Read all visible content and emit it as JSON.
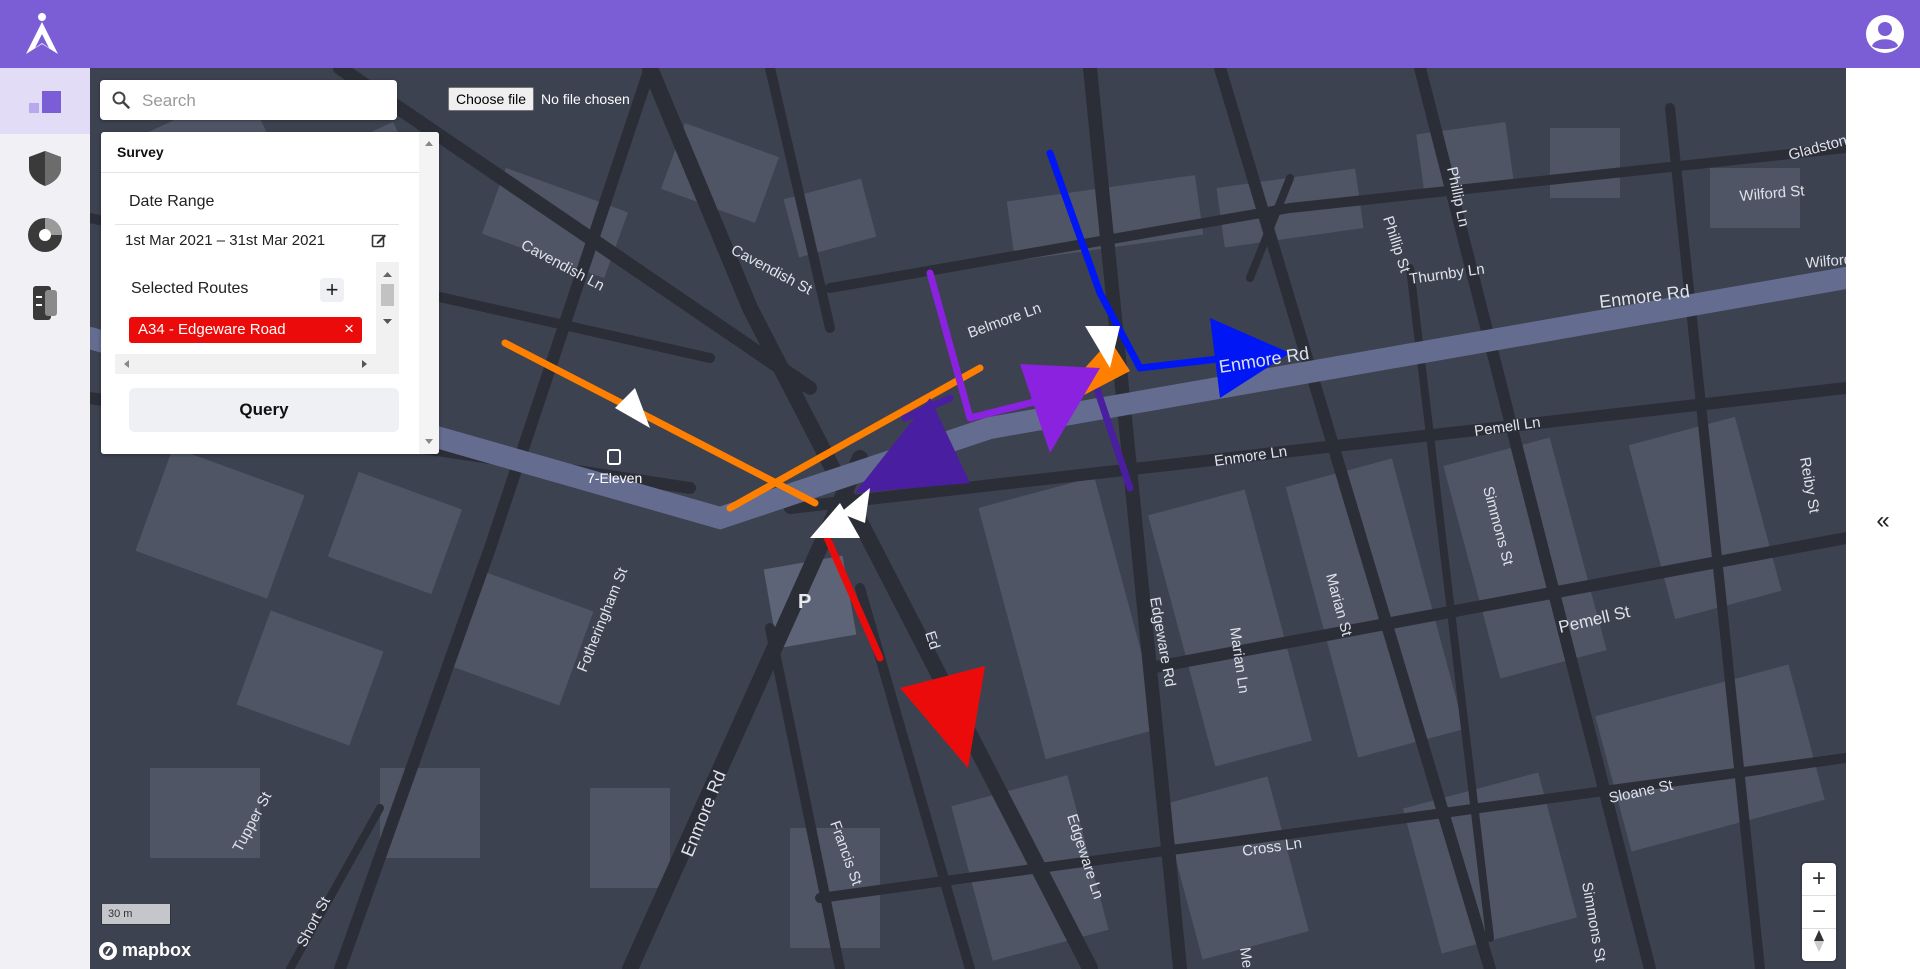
{
  "header": {
    "logo_icon": "compass-a-icon",
    "user_icon": "user-circle-icon",
    "bar_color": "#7b5dd5"
  },
  "sidebar": {
    "items": [
      {
        "name": "dashboard",
        "icon": "squares-icon"
      },
      {
        "name": "security",
        "icon": "shield-icon"
      },
      {
        "name": "analytics",
        "icon": "donut-icon"
      },
      {
        "name": "layers",
        "icon": "layers-icon"
      }
    ]
  },
  "search": {
    "placeholder": "Search"
  },
  "file_input": {
    "button_label": "Choose file",
    "status": "No file chosen"
  },
  "survey_panel": {
    "title": "Survey",
    "date_range_label": "Date Range",
    "date_range_value": "1st Mar 2021 – 31st Mar 2021",
    "selected_routes_label": "Selected Routes",
    "add_route_label": "+",
    "routes": [
      {
        "label": "A34 - Edgeware Road",
        "color": "#ec0b0b"
      }
    ],
    "query_label": "Query"
  },
  "map": {
    "street_labels": [
      "Cavendish Ln",
      "Cavendish St",
      "Belmore Ln",
      "Enmore Rd",
      "Enmore Rd",
      "Enmore Rd",
      "Enmore Ln",
      "Pemell Ln",
      "Pemell St",
      "Phillip Ln",
      "Phillip St",
      "Thurnby Ln",
      "Wilford St",
      "Wilford",
      "Gladstone",
      "Reiby St",
      "Simmons St",
      "Simmons St",
      "Marian Ln",
      "Marian St",
      "Edgeware Ln",
      "Edgeware Rd",
      "Fotheringham St",
      "Francis St",
      "Tupper St",
      "Short St",
      "Cross Ln",
      "Sloane St",
      "Me",
      "Ed"
    ],
    "poi_label": "7-Eleven",
    "parking_label": "P",
    "route_colors": {
      "orange": "#ff8000",
      "blue": "#0016f5",
      "purple": "#8a22e0",
      "dark_purple": "#4a1ea0",
      "red": "#ec0b0b"
    },
    "scale_label": "30 m",
    "attribution": "mapbox",
    "zoom_in": "+",
    "zoom_out": "−"
  },
  "right_panel": {
    "collapse_label": "«"
  }
}
